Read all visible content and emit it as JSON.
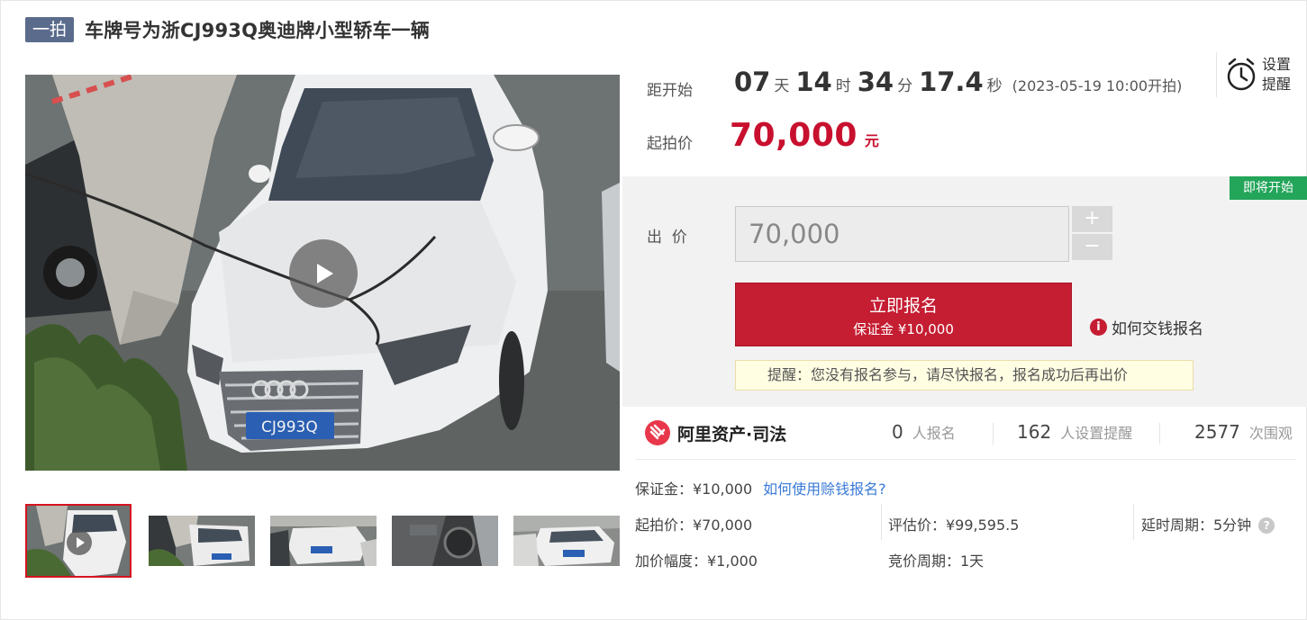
{
  "header": {
    "tag": "一拍",
    "title": "车牌号为浙CJ993Q奥迪牌小型轿车一辆"
  },
  "media": {
    "plate_text": "CJ993Q",
    "thumbnail_count": 5
  },
  "countdown": {
    "label": "距开始",
    "days": "07",
    "days_unit": "天",
    "hours": "14",
    "hours_unit": "时",
    "minutes": "34",
    "minutes_unit": "分",
    "seconds": "17.4",
    "seconds_unit": "秒",
    "start_note": "(2023-05-19 10:00开拍)"
  },
  "reminder": {
    "label": "设置提醒",
    "icon": "alarm-clock-icon"
  },
  "start_price": {
    "label": "起拍价",
    "value": "70,000",
    "unit": "元"
  },
  "bid": {
    "status_badge": "即将开始",
    "label": "出  价",
    "input_value": "70,000",
    "plus": "+",
    "minus": "−",
    "signup_label": "立即报名",
    "signup_sub": "保证金 ¥10,000",
    "howto_label": "如何交钱报名",
    "hint": "提醒：您没有报名参与，请尽快报名，报名成功后再出价"
  },
  "stats": {
    "brand_name": "阿里资产·司法",
    "signups_num": "0",
    "signups_label": "人报名",
    "reminders_num": "162",
    "reminders_label": "人设置提醒",
    "views_num": "2577",
    "views_label": "次围观"
  },
  "details": {
    "deposit": "保证金：¥10,000",
    "deposit_link": "如何使用赊钱报名?",
    "start_price": "起拍价：¥70,000",
    "appraisal": "评估价：¥99,595.5",
    "delay": "延时周期：5分钟",
    "increment": "加价幅度：¥1,000",
    "cycle": "竞价周期：1天"
  },
  "colors": {
    "accent_red": "#c51d32",
    "price_red": "#c8102e",
    "badge_green": "#23a55a",
    "link_blue": "#3a7ad6",
    "tag_bg": "#5a6b8c"
  }
}
